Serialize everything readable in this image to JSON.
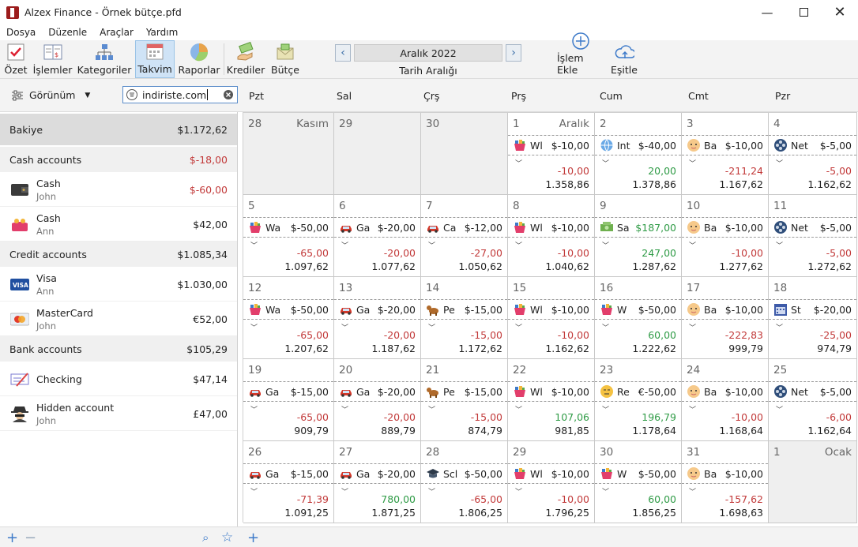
{
  "window": {
    "title": "Alzex Finance - Örnek bütçe.pfd"
  },
  "menu": [
    "Dosya",
    "Düzenle",
    "Araçlar",
    "Yardım"
  ],
  "toolbar": {
    "items": [
      "Özet",
      "İşlemler",
      "Kategoriler",
      "Takvim",
      "Raporlar",
      "Krediler",
      "Bütçe"
    ],
    "active": "Takvim",
    "date_value": "Aralık 2022",
    "date_label": "Tarih Aralığı",
    "add_label": "İşlem Ekle",
    "sync_label": "Eşitle"
  },
  "filter": {
    "view_label": "Görünüm",
    "search_value": "indiriste.com"
  },
  "days": [
    "Pzt",
    "Sal",
    "Çrş",
    "Prş",
    "Cum",
    "Cmt",
    "Pzr"
  ],
  "sidebar": {
    "balance": {
      "label": "Bakiye",
      "amount": "$1.172,62"
    },
    "groups": [
      {
        "label": "Cash accounts",
        "amount": "$-18,00",
        "neg": true,
        "accounts": [
          {
            "name": "Cash",
            "owner": "John",
            "amount": "$-60,00",
            "neg": true,
            "icon": "wallet-icon"
          },
          {
            "name": "Cash",
            "owner": "Ann",
            "amount": "$42,00",
            "neg": false,
            "icon": "purse-icon"
          }
        ]
      },
      {
        "label": "Credit accounts",
        "amount": "$1.085,34",
        "neg": false,
        "accounts": [
          {
            "name": "Visa",
            "owner": "Ann",
            "amount": "$1.030,00",
            "neg": false,
            "icon": "visa-icon"
          },
          {
            "name": "MasterCard",
            "owner": "John",
            "amount": "€52,00",
            "neg": false,
            "icon": "mastercard-icon"
          }
        ]
      },
      {
        "label": "Bank accounts",
        "amount": "$105,29",
        "neg": false,
        "accounts": [
          {
            "name": "Checking",
            "owner": "",
            "amount": "$47,14",
            "neg": false,
            "icon": "check-icon"
          },
          {
            "name": "Hidden account",
            "owner": "John",
            "amount": "£47,00",
            "neg": false,
            "icon": "spy-icon"
          }
        ]
      }
    ]
  },
  "calendar": {
    "weeks": [
      [
        {
          "day": "28",
          "month": "Kasım",
          "other": true
        },
        {
          "day": "29",
          "other": true
        },
        {
          "day": "30",
          "other": true
        },
        {
          "day": "1",
          "month": "Aralık",
          "tx": "Wl",
          "amt": "$-10,00",
          "icon": "basket-icon",
          "sum": "-10,00",
          "bal": "1.358,86"
        },
        {
          "day": "2",
          "tx": "Int",
          "amt": "$-40,00",
          "icon": "globe-icon",
          "sum": "20,00",
          "bal": "1.378,86"
        },
        {
          "day": "3",
          "tx": "Ba",
          "amt": "$-10,00",
          "icon": "baby-icon",
          "sum": "-211,24",
          "bal": "1.167,62"
        },
        {
          "day": "4",
          "tx": "Net",
          "amt": "$-5,00",
          "icon": "film-icon",
          "sum": "-5,00",
          "bal": "1.162,62"
        }
      ],
      [
        {
          "day": "5",
          "tx": "Wa",
          "amt": "$-50,00",
          "icon": "basket-icon",
          "sum": "-65,00",
          "bal": "1.097,62"
        },
        {
          "day": "6",
          "tx": "Ga",
          "amt": "$-20,00",
          "icon": "car-icon",
          "sum": "-20,00",
          "bal": "1.077,62"
        },
        {
          "day": "7",
          "tx": "Ca",
          "amt": "$-12,00",
          "icon": "car-icon",
          "sum": "-27,00",
          "bal": "1.050,62"
        },
        {
          "day": "8",
          "tx": "Wl",
          "amt": "$-10,00",
          "icon": "basket-icon",
          "sum": "-10,00",
          "bal": "1.040,62"
        },
        {
          "day": "9",
          "tx": "Sa",
          "amt": "$187,00",
          "amtpos": true,
          "icon": "money-icon",
          "sum": "247,00",
          "bal": "1.287,62"
        },
        {
          "day": "10",
          "tx": "Ba",
          "amt": "$-10,00",
          "icon": "baby-icon",
          "sum": "-10,00",
          "bal": "1.277,62"
        },
        {
          "day": "11",
          "tx": "Net",
          "amt": "$-5,00",
          "icon": "film-icon",
          "sum": "-5,00",
          "bal": "1.272,62"
        }
      ],
      [
        {
          "day": "12",
          "tx": "Wa",
          "amt": "$-50,00",
          "icon": "basket-icon",
          "sum": "-65,00",
          "bal": "1.207,62"
        },
        {
          "day": "13",
          "tx": "Ga",
          "amt": "$-20,00",
          "icon": "car-icon",
          "sum": "-20,00",
          "bal": "1.187,62"
        },
        {
          "day": "14",
          "tx": "Pe",
          "amt": "$-15,00",
          "icon": "dog-icon",
          "sum": "-15,00",
          "bal": "1.172,62"
        },
        {
          "day": "15",
          "tx": "Wl",
          "amt": "$-10,00",
          "icon": "basket-icon",
          "sum": "-10,00",
          "bal": "1.162,62"
        },
        {
          "day": "16",
          "tx": "W",
          "amt": "$-50,00",
          "icon": "basket-icon",
          "sum": "60,00",
          "bal": "1.222,62"
        },
        {
          "day": "17",
          "tx": "Ba",
          "amt": "$-10,00",
          "icon": "baby-icon",
          "sum": "-222,83",
          "bal": "999,79"
        },
        {
          "day": "18",
          "tx": "St",
          "amt": "$-20,00",
          "icon": "calendar-icon",
          "sum": "-25,00",
          "bal": "974,79"
        }
      ],
      [
        {
          "day": "19",
          "tx": "Ga",
          "amt": "$-15,00",
          "icon": "car-icon",
          "sum": "-65,00",
          "bal": "909,79"
        },
        {
          "day": "20",
          "tx": "Ga",
          "amt": "$-20,00",
          "icon": "car-icon",
          "sum": "-20,00",
          "bal": "889,79"
        },
        {
          "day": "21",
          "tx": "Pe",
          "amt": "$-15,00",
          "icon": "dog-icon",
          "sum": "-15,00",
          "bal": "874,79"
        },
        {
          "day": "22",
          "tx": "Wl",
          "amt": "$-10,00",
          "icon": "basket-icon",
          "sum": "107,06",
          "bal": "981,85"
        },
        {
          "day": "23",
          "tx": "Re",
          "amt": "€-50,00",
          "icon": "face-icon",
          "sum": "196,79",
          "bal": "1.178,64"
        },
        {
          "day": "24",
          "tx": "Ba",
          "amt": "$-10,00",
          "icon": "baby-icon",
          "sum": "-10,00",
          "bal": "1.168,64"
        },
        {
          "day": "25",
          "tx": "Net",
          "amt": "$-5,00",
          "icon": "film-icon",
          "sum": "-6,00",
          "bal": "1.162,64"
        }
      ],
      [
        {
          "day": "26",
          "tx": "Ga",
          "amt": "$-15,00",
          "icon": "car-icon",
          "sum": "-71,39",
          "bal": "1.091,25"
        },
        {
          "day": "27",
          "tx": "Ga",
          "amt": "$-20,00",
          "icon": "car-icon",
          "sum": "780,00",
          "bal": "1.871,25"
        },
        {
          "day": "28",
          "tx": "Scl",
          "amt": "$-50,00",
          "icon": "graduation-icon",
          "sum": "-65,00",
          "bal": "1.806,25"
        },
        {
          "day": "29",
          "tx": "Wl",
          "amt": "$-10,00",
          "icon": "basket-icon",
          "sum": "-10,00",
          "bal": "1.796,25"
        },
        {
          "day": "30",
          "tx": "W",
          "amt": "$-50,00",
          "icon": "basket-icon",
          "sum": "60,00",
          "bal": "1.856,25"
        },
        {
          "day": "31",
          "tx": "Ba",
          "amt": "$-10,00",
          "icon": "baby-icon",
          "sum": "-157,62",
          "bal": "1.698,63"
        },
        {
          "day": "1",
          "month": "Ocak",
          "other": true
        }
      ]
    ]
  }
}
